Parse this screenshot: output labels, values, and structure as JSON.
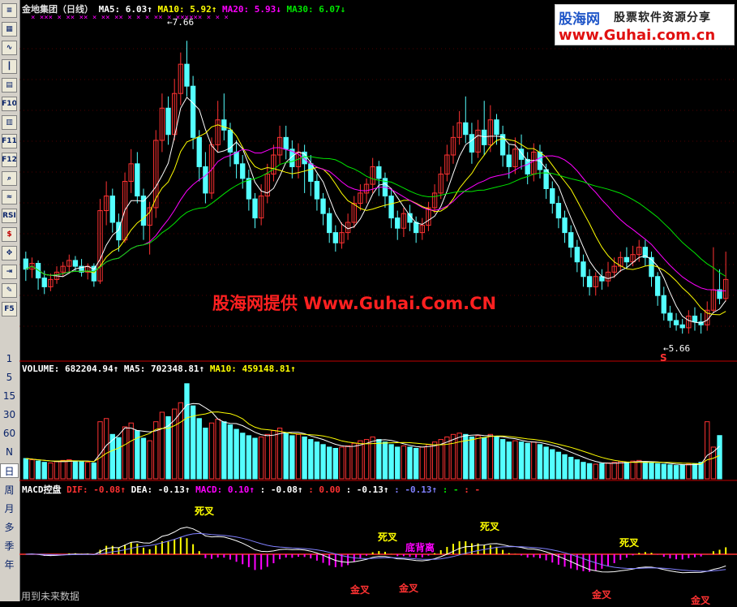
{
  "toolbar": {
    "buttons": [
      {
        "label": "≡",
        "icon": "list-icon"
      },
      {
        "label": "▦",
        "icon": "grid-icon"
      },
      {
        "label": "∿",
        "icon": "line-chart-icon"
      },
      {
        "label": "┃",
        "icon": "candle-icon"
      },
      {
        "label": "▤",
        "icon": "table-icon"
      },
      {
        "label": "F10",
        "icon": "f10-icon"
      },
      {
        "label": "▥",
        "icon": "report-icon"
      },
      {
        "label": "F11",
        "icon": "f11-icon"
      },
      {
        "label": "F12",
        "icon": "f12-icon"
      },
      {
        "label": "⌕",
        "icon": "search-icon"
      },
      {
        "label": "≈",
        "icon": "indicator-icon"
      },
      {
        "label": "RSI",
        "icon": "rsi-icon"
      },
      {
        "label": "$",
        "icon": "dollar-icon"
      },
      {
        "label": "✥",
        "icon": "move-icon"
      },
      {
        "label": "⇥",
        "icon": "exit-icon"
      },
      {
        "label": "✎",
        "icon": "pencil-icon"
      },
      {
        "label": "F5",
        "icon": "f5-icon"
      }
    ],
    "periods": [
      "1",
      "5",
      "15",
      "30",
      "60",
      "N",
      "日",
      "周",
      "月",
      "多",
      "季",
      "年"
    ],
    "selected_period": "日"
  },
  "header": {
    "stock": "金地集团（日线）",
    "ma5": "MA5: 6.03↑",
    "ma10": "MA10: 5.92↑",
    "ma20": "MA20: 5.93↓",
    "ma30": "MA30: 6.07↓"
  },
  "volume_header": {
    "volume": "VOLUME: 682204.94↑",
    "ma5": "MA5: 702348.81↑",
    "ma10": "MA10: 459148.81↑"
  },
  "macd_header": {
    "title": "MACD控盘",
    "dif": "DIF: -0.08↑",
    "dea": "DEA: -0.13↑",
    "macd": "MACD: 0.10↑",
    "extra1": ": -0.08↑",
    "extra2": ": 0.00",
    "extra3": ": -0.13↑",
    "extra4": ": -0.13↑",
    "extra5": ": -",
    "extra6": ": -"
  },
  "brand": {
    "name": "股海网",
    "slogan": "股票软件资源分享",
    "url": "www.Guhai.com.cn"
  },
  "watermark": "股海网提供 Www.Guhai.Com.CN",
  "price_labels": {
    "high": "7.66",
    "low": "5.66",
    "signal": "S"
  },
  "annotations": {
    "death_cross": "死叉",
    "golden_cross": "金叉",
    "bottom_divergence": "底背离"
  },
  "footer": "用到未来数据",
  "colors": {
    "up": "#ff3232",
    "down": "#54ffff",
    "ma5": "#ffffff",
    "ma10": "#ffff00",
    "ma20": "#ff00ff",
    "ma30": "#00e600",
    "grid": "#a00000"
  },
  "chart_data": {
    "type": "candlestick",
    "price_axis_hint": [
      5.5,
      7.8
    ],
    "candles": [
      {
        "o": 6.17,
        "c": 6.1,
        "h": 6.22,
        "l": 6.02
      },
      {
        "o": 6.1,
        "c": 6.14,
        "h": 6.18,
        "l": 6.04
      },
      {
        "o": 6.14,
        "c": 6.04,
        "h": 6.16,
        "l": 5.96
      },
      {
        "o": 6.04,
        "c": 5.98,
        "h": 6.09,
        "l": 5.93
      },
      {
        "o": 5.98,
        "c": 6.03,
        "h": 6.07,
        "l": 5.95
      },
      {
        "o": 6.03,
        "c": 6.08,
        "h": 6.12,
        "l": 6.0
      },
      {
        "o": 6.08,
        "c": 6.12,
        "h": 6.15,
        "l": 6.05
      },
      {
        "o": 6.12,
        "c": 6.16,
        "h": 6.2,
        "l": 6.08
      },
      {
        "o": 6.16,
        "c": 6.12,
        "h": 6.19,
        "l": 6.09
      },
      {
        "o": 6.12,
        "c": 6.08,
        "h": 6.17,
        "l": 6.05
      },
      {
        "o": 6.08,
        "c": 6.12,
        "h": 6.14,
        "l": 6.03
      },
      {
        "o": 6.12,
        "c": 6.02,
        "h": 6.14,
        "l": 5.98
      },
      {
        "o": 6.02,
        "c": 6.5,
        "h": 6.58,
        "l": 6.0
      },
      {
        "o": 6.5,
        "c": 6.6,
        "h": 6.7,
        "l": 6.4
      },
      {
        "o": 6.6,
        "c": 6.42,
        "h": 6.65,
        "l": 6.35
      },
      {
        "o": 6.42,
        "c": 6.3,
        "h": 6.48,
        "l": 6.22
      },
      {
        "o": 6.3,
        "c": 6.7,
        "h": 6.76,
        "l": 6.28
      },
      {
        "o": 6.7,
        "c": 6.82,
        "h": 6.92,
        "l": 6.62
      },
      {
        "o": 6.82,
        "c": 6.6,
        "h": 6.9,
        "l": 6.55
      },
      {
        "o": 6.6,
        "c": 6.4,
        "h": 6.65,
        "l": 6.3
      },
      {
        "o": 6.4,
        "c": 6.52,
        "h": 6.56,
        "l": 6.2
      },
      {
        "o": 6.52,
        "c": 6.98,
        "h": 7.05,
        "l": 6.45
      },
      {
        "o": 6.98,
        "c": 7.2,
        "h": 7.3,
        "l": 6.9
      },
      {
        "o": 7.2,
        "c": 7.02,
        "h": 7.28,
        "l": 6.95
      },
      {
        "o": 7.02,
        "c": 7.3,
        "h": 7.4,
        "l": 6.98
      },
      {
        "o": 7.3,
        "c": 7.5,
        "h": 7.58,
        "l": 7.22
      },
      {
        "o": 7.5,
        "c": 7.35,
        "h": 7.66,
        "l": 7.28
      },
      {
        "o": 7.35,
        "c": 7.0,
        "h": 7.42,
        "l": 6.92
      },
      {
        "o": 7.0,
        "c": 6.8,
        "h": 7.05,
        "l": 6.7
      },
      {
        "o": 6.8,
        "c": 6.62,
        "h": 6.9,
        "l": 6.55
      },
      {
        "o": 6.62,
        "c": 6.95,
        "h": 7.0,
        "l": 6.58
      },
      {
        "o": 6.95,
        "c": 7.12,
        "h": 7.25,
        "l": 6.9
      },
      {
        "o": 7.12,
        "c": 7.05,
        "h": 7.3,
        "l": 6.98
      },
      {
        "o": 7.05,
        "c": 6.9,
        "h": 7.1,
        "l": 6.8
      },
      {
        "o": 6.9,
        "c": 6.82,
        "h": 6.98,
        "l": 6.72
      },
      {
        "o": 6.82,
        "c": 6.72,
        "h": 6.88,
        "l": 6.65
      },
      {
        "o": 6.72,
        "c": 6.58,
        "h": 6.78,
        "l": 6.5
      },
      {
        "o": 6.58,
        "c": 6.45,
        "h": 6.62,
        "l": 6.38
      },
      {
        "o": 6.45,
        "c": 6.6,
        "h": 6.68,
        "l": 6.4
      },
      {
        "o": 6.6,
        "c": 6.75,
        "h": 6.82,
        "l": 6.55
      },
      {
        "o": 6.75,
        "c": 6.88,
        "h": 6.95,
        "l": 6.7
      },
      {
        "o": 6.88,
        "c": 7.0,
        "h": 7.08,
        "l": 6.82
      },
      {
        "o": 7.0,
        "c": 6.92,
        "h": 7.08,
        "l": 6.85
      },
      {
        "o": 6.92,
        "c": 6.8,
        "h": 6.98,
        "l": 6.72
      },
      {
        "o": 6.8,
        "c": 6.9,
        "h": 6.96,
        "l": 6.72
      },
      {
        "o": 6.9,
        "c": 6.82,
        "h": 6.95,
        "l": 6.62
      },
      {
        "o": 6.82,
        "c": 6.7,
        "h": 6.88,
        "l": 6.6
      },
      {
        "o": 6.7,
        "c": 6.58,
        "h": 6.75,
        "l": 6.5
      },
      {
        "o": 6.58,
        "c": 6.48,
        "h": 6.62,
        "l": 6.4
      },
      {
        "o": 6.48,
        "c": 6.35,
        "h": 6.52,
        "l": 6.28
      },
      {
        "o": 6.35,
        "c": 6.28,
        "h": 6.4,
        "l": 6.22
      },
      {
        "o": 6.28,
        "c": 6.35,
        "h": 6.42,
        "l": 6.24
      },
      {
        "o": 6.35,
        "c": 6.42,
        "h": 6.48,
        "l": 6.3
      },
      {
        "o": 6.42,
        "c": 6.55,
        "h": 6.6,
        "l": 6.38
      },
      {
        "o": 6.55,
        "c": 6.62,
        "h": 6.68,
        "l": 6.5
      },
      {
        "o": 6.62,
        "c": 6.68,
        "h": 6.72,
        "l": 6.55
      },
      {
        "o": 6.68,
        "c": 6.8,
        "h": 6.86,
        "l": 6.62
      },
      {
        "o": 6.8,
        "c": 6.72,
        "h": 6.84,
        "l": 6.6
      },
      {
        "o": 6.72,
        "c": 6.6,
        "h": 6.76,
        "l": 6.52
      },
      {
        "o": 6.6,
        "c": 6.45,
        "h": 6.65,
        "l": 6.38
      },
      {
        "o": 6.45,
        "c": 6.38,
        "h": 6.5,
        "l": 6.3
      },
      {
        "o": 6.38,
        "c": 6.48,
        "h": 6.52,
        "l": 6.32
      },
      {
        "o": 6.48,
        "c": 6.42,
        "h": 6.54,
        "l": 6.36
      },
      {
        "o": 6.42,
        "c": 6.35,
        "h": 6.46,
        "l": 6.28
      },
      {
        "o": 6.35,
        "c": 6.4,
        "h": 6.45,
        "l": 6.3
      },
      {
        "o": 6.4,
        "c": 6.52,
        "h": 6.56,
        "l": 6.36
      },
      {
        "o": 6.52,
        "c": 6.62,
        "h": 6.68,
        "l": 6.48
      },
      {
        "o": 6.62,
        "c": 6.75,
        "h": 6.8,
        "l": 6.58
      },
      {
        "o": 6.75,
        "c": 6.88,
        "h": 6.95,
        "l": 6.7
      },
      {
        "o": 6.88,
        "c": 7.0,
        "h": 7.08,
        "l": 6.82
      },
      {
        "o": 7.0,
        "c": 7.1,
        "h": 7.18,
        "l": 6.95
      },
      {
        "o": 7.1,
        "c": 7.02,
        "h": 7.28,
        "l": 6.96
      },
      {
        "o": 7.02,
        "c": 6.9,
        "h": 7.1,
        "l": 6.82
      },
      {
        "o": 6.9,
        "c": 7.05,
        "h": 7.12,
        "l": 6.86
      },
      {
        "o": 7.05,
        "c": 6.95,
        "h": 7.25,
        "l": 6.88
      },
      {
        "o": 6.95,
        "c": 7.12,
        "h": 7.22,
        "l": 6.9
      },
      {
        "o": 7.12,
        "c": 7.02,
        "h": 7.16,
        "l": 6.95
      },
      {
        "o": 7.02,
        "c": 6.88,
        "h": 7.08,
        "l": 6.8
      },
      {
        "o": 6.88,
        "c": 6.8,
        "h": 6.95,
        "l": 6.72
      },
      {
        "o": 6.8,
        "c": 6.92,
        "h": 7.0,
        "l": 6.75
      },
      {
        "o": 6.92,
        "c": 6.85,
        "h": 7.02,
        "l": 6.78
      },
      {
        "o": 6.85,
        "c": 6.75,
        "h": 6.9,
        "l": 6.68
      },
      {
        "o": 6.75,
        "c": 6.9,
        "h": 6.96,
        "l": 6.7
      },
      {
        "o": 6.9,
        "c": 6.78,
        "h": 6.95,
        "l": 6.72
      },
      {
        "o": 6.78,
        "c": 6.65,
        "h": 6.82,
        "l": 6.58
      },
      {
        "o": 6.65,
        "c": 6.55,
        "h": 6.7,
        "l": 6.48
      },
      {
        "o": 6.55,
        "c": 6.45,
        "h": 6.6,
        "l": 6.38
      },
      {
        "o": 6.45,
        "c": 6.35,
        "h": 6.5,
        "l": 6.28
      },
      {
        "o": 6.35,
        "c": 6.25,
        "h": 6.4,
        "l": 6.18
      },
      {
        "o": 6.25,
        "c": 6.15,
        "h": 6.3,
        "l": 6.08
      },
      {
        "o": 6.15,
        "c": 6.05,
        "h": 6.2,
        "l": 5.98
      },
      {
        "o": 6.05,
        "c": 5.98,
        "h": 6.1,
        "l": 5.92
      },
      {
        "o": 5.98,
        "c": 6.05,
        "h": 6.08,
        "l": 5.92
      },
      {
        "o": 6.05,
        "c": 6.02,
        "h": 6.1,
        "l": 5.96
      },
      {
        "o": 6.02,
        "c": 6.08,
        "h": 6.15,
        "l": 5.98
      },
      {
        "o": 6.08,
        "c": 6.12,
        "h": 6.18,
        "l": 6.04
      },
      {
        "o": 6.12,
        "c": 6.18,
        "h": 6.22,
        "l": 6.08
      },
      {
        "o": 6.18,
        "c": 6.15,
        "h": 6.25,
        "l": 6.1
      },
      {
        "o": 6.15,
        "c": 6.2,
        "h": 6.26,
        "l": 6.12
      },
      {
        "o": 6.2,
        "c": 6.25,
        "h": 6.3,
        "l": 6.15
      },
      {
        "o": 6.25,
        "c": 6.18,
        "h": 6.3,
        "l": 6.12
      },
      {
        "o": 6.18,
        "c": 6.05,
        "h": 6.22,
        "l": 5.98
      },
      {
        "o": 6.05,
        "c": 5.92,
        "h": 6.08,
        "l": 5.85
      },
      {
        "o": 5.92,
        "c": 5.8,
        "h": 5.98,
        "l": 5.75
      },
      {
        "o": 5.8,
        "c": 5.75,
        "h": 5.85,
        "l": 5.7
      },
      {
        "o": 5.75,
        "c": 5.72,
        "h": 5.8,
        "l": 5.68
      },
      {
        "o": 5.72,
        "c": 5.7,
        "h": 5.76,
        "l": 5.66
      },
      {
        "o": 5.7,
        "c": 5.78,
        "h": 5.82,
        "l": 5.66
      },
      {
        "o": 5.78,
        "c": 5.74,
        "h": 5.84,
        "l": 5.68
      },
      {
        "o": 5.74,
        "c": 5.72,
        "h": 5.8,
        "l": 5.66
      },
      {
        "o": 5.72,
        "c": 5.82,
        "h": 5.88,
        "l": 5.68
      },
      {
        "o": 5.82,
        "c": 5.96,
        "h": 6.25,
        "l": 5.8
      },
      {
        "o": 5.96,
        "c": 5.9,
        "h": 6.1,
        "l": 5.86
      },
      {
        "o": 5.9,
        "c": 6.03,
        "h": 6.22,
        "l": 5.88
      }
    ],
    "volume": [
      320,
      300,
      280,
      260,
      250,
      270,
      290,
      300,
      280,
      270,
      260,
      250,
      900,
      950,
      700,
      650,
      820,
      880,
      760,
      640,
      600,
      900,
      1050,
      980,
      1100,
      1200,
      1500,
      1150,
      950,
      800,
      880,
      940,
      900,
      850,
      780,
      720,
      680,
      640,
      660,
      700,
      760,
      800,
      720,
      680,
      700,
      660,
      620,
      580,
      540,
      500,
      480,
      500,
      520,
      560,
      600,
      620,
      660,
      620,
      580,
      540,
      500,
      520,
      500,
      480,
      500,
      540,
      580,
      620,
      660,
      700,
      720,
      700,
      660,
      680,
      650,
      700,
      660,
      620,
      580,
      600,
      580,
      560,
      580,
      540,
      500,
      460,
      420,
      380,
      340,
      300,
      260,
      240,
      230,
      240,
      250,
      260,
      270,
      260,
      280,
      290,
      270,
      250,
      240,
      230,
      220,
      210,
      220,
      230,
      240,
      260,
      900,
      500,
      682
    ]
  }
}
